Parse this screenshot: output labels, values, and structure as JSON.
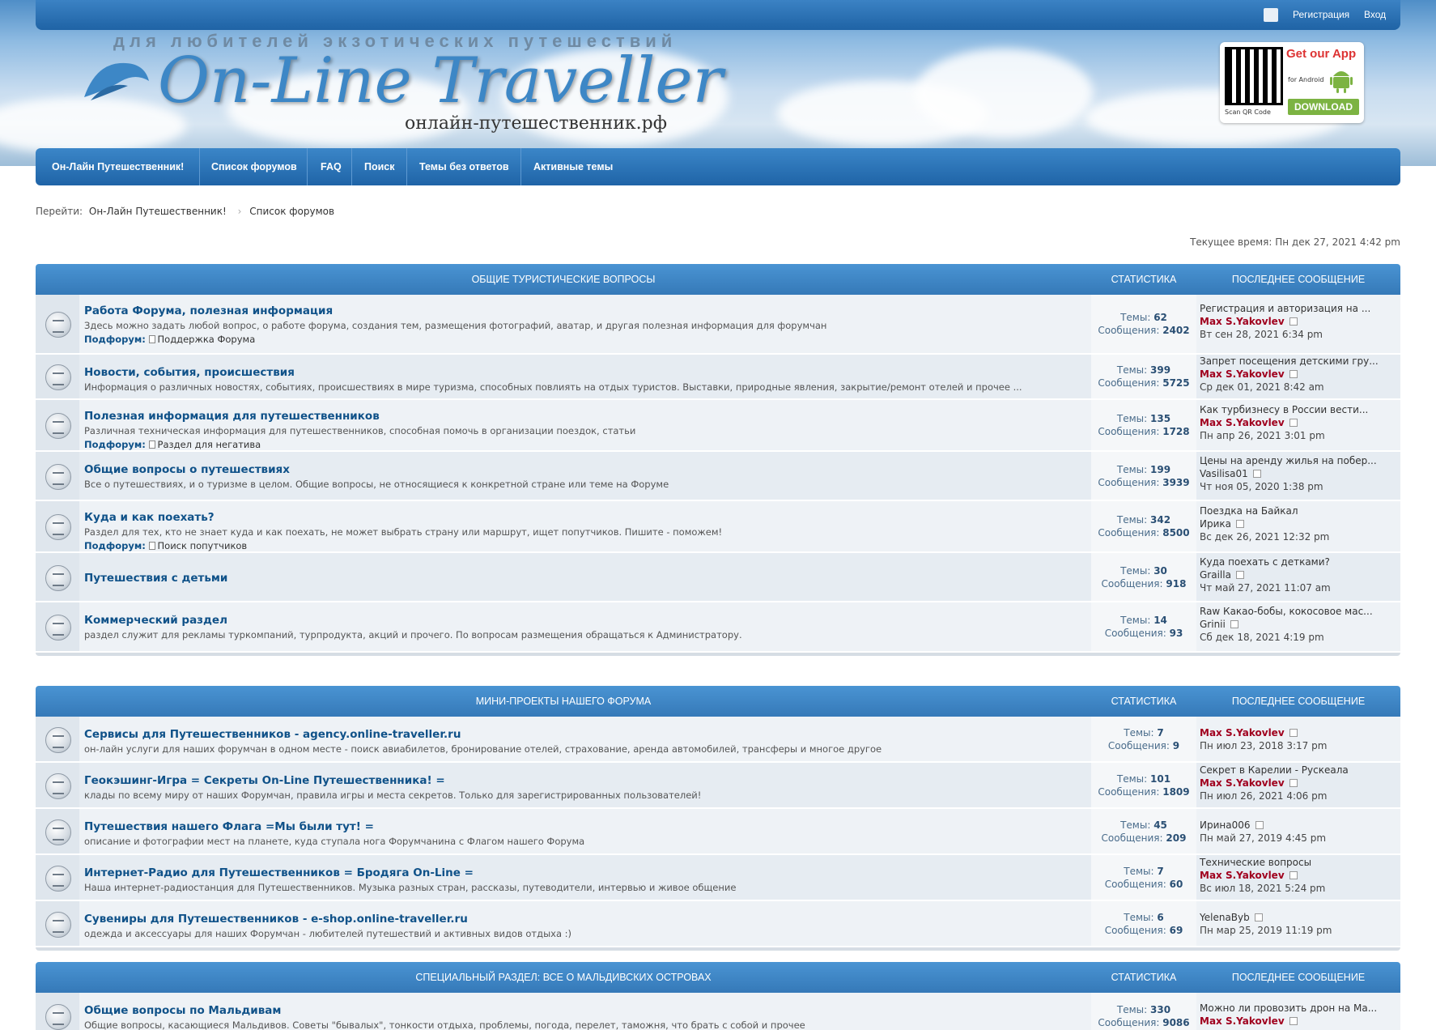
{
  "topbar": {
    "register": "Регистрация",
    "login": "Вход"
  },
  "header": {
    "tagline": "для любителей экзотических путешествий",
    "logo": "On-Line Traveller",
    "domain": "онлайн-путешественник.рф",
    "app": {
      "title": "Get our App",
      "sub": "for Android",
      "qr_label": "Scan QR Code",
      "download": "DOWNLOAD"
    }
  },
  "nav": [
    "Он-Лайн Путешественник!",
    "Список форумов",
    "FAQ",
    "Поиск",
    "Темы без ответов",
    "Активные темы"
  ],
  "breadcrumb": {
    "prefix": "Перейти:",
    "items": [
      "Он-Лайн Путешественник!",
      "Список форумов"
    ]
  },
  "current_time": "Текущее время: Пн дек 27, 2021 4:42 pm",
  "sections": [
    {
      "title": "ОБЩИЕ ТУРИСТИЧЕСКИЕ ВОПРОСЫ",
      "stat_header": "СТАТИСТИКА",
      "last_header": "ПОСЛЕДНЕЕ СООБЩЕНИЕ",
      "forums": [
        {
          "title": "Работа Форума, полезная информация",
          "desc": "Здесь можно задать любой вопрос, о работе форума, создания тем, размещения фотографий, аватар, и другая полезная информация для форумчан",
          "sub_label": "Подфорум:",
          "sub": "Поддержка Форума",
          "topics_label": "Темы:",
          "topics": "62",
          "posts_label": "Сообщения:",
          "posts": "2402",
          "last_title": "Регистрация и авторизация на ...",
          "last_author": "Max S.Yakovlev",
          "author_style": "red",
          "last_date": "Вт сен 28, 2021 6:34 pm"
        },
        {
          "title": "Новости, события, происшествия",
          "desc": "Информация о различных новостях, событиях, происшествиях в мире туризма, способных повлиять на отдых туристов. Выставки, природные явления, закрытие/ремонт отелей и прочее ...",
          "sub_label": "",
          "sub": "",
          "topics_label": "Темы:",
          "topics": "399",
          "posts_label": "Сообщения:",
          "posts": "5725",
          "last_title": "Запрет посещения детскими гру...",
          "last_author": "Max S.Yakovlev",
          "author_style": "red",
          "last_date": "Ср дек 01, 2021 8:42 am"
        },
        {
          "title": "Полезная информация для путешественников",
          "desc": "Различная техническая информация для путешественников, способная помочь в организации поездок, статьи",
          "sub_label": "Подфорум:",
          "sub": "Раздел для негатива",
          "topics_label": "Темы:",
          "topics": "135",
          "posts_label": "Сообщения:",
          "posts": "1728",
          "last_title": "Как турбизнесу в России вести...",
          "last_author": "Max S.Yakovlev",
          "author_style": "red",
          "last_date": "Пн апр 26, 2021 3:01 pm"
        },
        {
          "title": "Общие вопросы о путешествиях",
          "desc": "Все о путешествиях, и о туризме в целом. Общие вопросы, не относящиеся к конкретной стране или теме на Форуме",
          "sub_label": "",
          "sub": "",
          "topics_label": "Темы:",
          "topics": "199",
          "posts_label": "Сообщения:",
          "posts": "3939",
          "last_title": "Цены на аренду жилья на побер...",
          "last_author": "Vasilisa01",
          "author_style": "plain",
          "last_date": "Чт ноя 05, 2020 1:38 pm"
        },
        {
          "title": "Куда и как поехать?",
          "desc": "Раздел для тех, кто не знает куда и как поехать, не может выбрать страну или маршрут, ищет попутчиков. Пишите - поможем!",
          "sub_label": "Подфорум:",
          "sub": "Поиск попутчиков",
          "topics_label": "Темы:",
          "topics": "342",
          "posts_label": "Сообщения:",
          "posts": "8500",
          "last_title": "Поездка на Байкал",
          "last_author": "Ирика",
          "author_style": "plain",
          "last_date": "Вс дек 26, 2021 12:32 pm"
        },
        {
          "title": "Путешествия с детьми",
          "desc": "",
          "sub_label": "",
          "sub": "",
          "topics_label": "Темы:",
          "topics": "30",
          "posts_label": "Сообщения:",
          "posts": "918",
          "last_title": "Куда поехать с детками?",
          "last_author": "Grailla",
          "author_style": "plain",
          "last_date": "Чт май 27, 2021 11:07 am"
        },
        {
          "title": "Коммерческий раздел",
          "desc": "раздел служит для рекламы туркомпаний, турпродукта, акций и прочего. По вопросам размещения обращаться к Администратору.",
          "sub_label": "",
          "sub": "",
          "topics_label": "Темы:",
          "topics": "14",
          "posts_label": "Сообщения:",
          "posts": "93",
          "last_title": "Raw Какао-бобы, кокосовое мас...",
          "last_author": "Grinii",
          "author_style": "plain",
          "last_date": "Сб дек 18, 2021 4:19 pm"
        }
      ]
    },
    {
      "title": "МИНИ-ПРОЕКТЫ НАШЕГО ФОРУМА",
      "stat_header": "СТАТИСТИКА",
      "last_header": "ПОСЛЕДНЕЕ СООБЩЕНИЕ",
      "forums": [
        {
          "title": "Сервисы для Путешественников - agency.online-traveller.ru",
          "desc": "он-лайн услуги для наших форумчан в одном месте - поиск авиабилетов, бронирование отелей, страхование, аренда автомобилей, трансферы и многое другое",
          "sub_label": "",
          "sub": "",
          "topics_label": "Темы:",
          "topics": "7",
          "posts_label": "Сообщения:",
          "posts": "9",
          "last_title": "",
          "last_author": "Max S.Yakovlev",
          "author_style": "red",
          "last_date": "Пн июл 23, 2018 3:17 pm"
        },
        {
          "title": "Геокэшинг-Игра = Секреты On-Line Путешественника! =",
          "desc": "клады по всему миру от наших Форумчан, правила игры и места секретов. Только для зарегистрированных пользователей!",
          "sub_label": "",
          "sub": "",
          "topics_label": "Темы:",
          "topics": "101",
          "posts_label": "Сообщения:",
          "posts": "1809",
          "last_title": "Секрет в Карелии - Рускеала",
          "last_author": "Max S.Yakovlev",
          "author_style": "red",
          "last_date": "Пн июл 26, 2021 4:06 pm"
        },
        {
          "title": "Путешествия нашего Флага =Мы были тут! =",
          "desc": "описание и фотографии мест на планете, куда ступала нога Форумчанина с Флагом нашего Форума",
          "sub_label": "",
          "sub": "",
          "topics_label": "Темы:",
          "topics": "45",
          "posts_label": "Сообщения:",
          "posts": "209",
          "last_title": "",
          "last_author": "Ирина006",
          "author_style": "plain",
          "last_date": "Пн май 27, 2019 4:45 pm"
        },
        {
          "title": "Интернет-Радио для Путешественников = Бродяга On-Line =",
          "desc": "Наша интернет-радиостанция для Путешественников. Музыка разных стран, рассказы, путеводители, интервью и живое общение",
          "sub_label": "",
          "sub": "",
          "topics_label": "Темы:",
          "topics": "7",
          "posts_label": "Сообщения:",
          "posts": "60",
          "last_title": "Технические вопросы",
          "last_author": "Max S.Yakovlev",
          "author_style": "red",
          "last_date": "Вс июл 18, 2021 5:24 pm"
        },
        {
          "title": "Сувениры для Путешественников - e-shop.online-traveller.ru",
          "desc": "одежда и аксессуары для наших Форумчан - любителей путешествий и активных видов отдыха :)",
          "sub_label": "",
          "sub": "",
          "topics_label": "Темы:",
          "topics": "6",
          "posts_label": "Сообщения:",
          "posts": "69",
          "last_title": "",
          "last_author": "YelenaByb",
          "author_style": "plain",
          "last_date": "Пн мар 25, 2019 11:19 pm"
        }
      ]
    },
    {
      "title": "СПЕЦИАЛЬНЫЙ РАЗДЕЛ: ВСЕ О МАЛЬДИВСКИХ ОСТРОВАХ",
      "stat_header": "СТАТИСТИКА",
      "last_header": "ПОСЛЕДНЕЕ СООБЩЕНИЕ",
      "forums": [
        {
          "title": "Общие вопросы по Мальдивам",
          "desc": "Общие вопросы, касающиеся Мальдивов. Советы \"бывалых\", тонкости отдыха, проблемы, погода, перелет, таможня, что брать с собой и прочее",
          "sub_label": "",
          "sub": "",
          "topics_label": "Темы:",
          "topics": "330",
          "posts_label": "Сообщения:",
          "posts": "9086",
          "last_title": "Можно ли провозить дрон на Ма...",
          "last_author": "Max S.Yakovlev",
          "author_style": "red",
          "last_date": ""
        }
      ]
    }
  ]
}
